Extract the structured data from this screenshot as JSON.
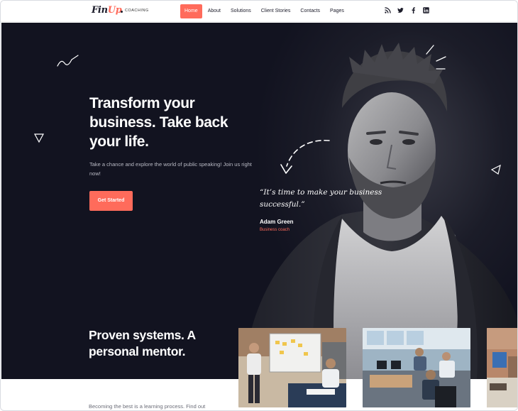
{
  "header": {
    "logo_main": "Fin",
    "logo_accent": "Up",
    "logo_sub": "COACHING",
    "nav": [
      {
        "label": "Home",
        "active": true
      },
      {
        "label": "About",
        "active": false
      },
      {
        "label": "Solutions",
        "active": false
      },
      {
        "label": "Client Stories",
        "active": false
      },
      {
        "label": "Contacts",
        "active": false
      },
      {
        "label": "Pages",
        "active": false
      }
    ],
    "social": [
      "rss-icon",
      "twitter-icon",
      "facebook-icon",
      "linkedin-icon"
    ]
  },
  "hero": {
    "headline": "Transform your business. Take back your life.",
    "subtext": "Take a chance and explore the world of public speaking! Join us right now!",
    "cta": "Get Started",
    "quote": "“It’s time to make your business successful.”",
    "author_name": "Adam Green",
    "author_role": "Business coach"
  },
  "section2": {
    "title": "Proven systems. A personal mentor.",
    "text": "Becoming the best is a learning process. Find out"
  },
  "colors": {
    "accent": "#ff6b5b",
    "hero_bg": "#121320",
    "text_dark": "#1c1c2a"
  }
}
